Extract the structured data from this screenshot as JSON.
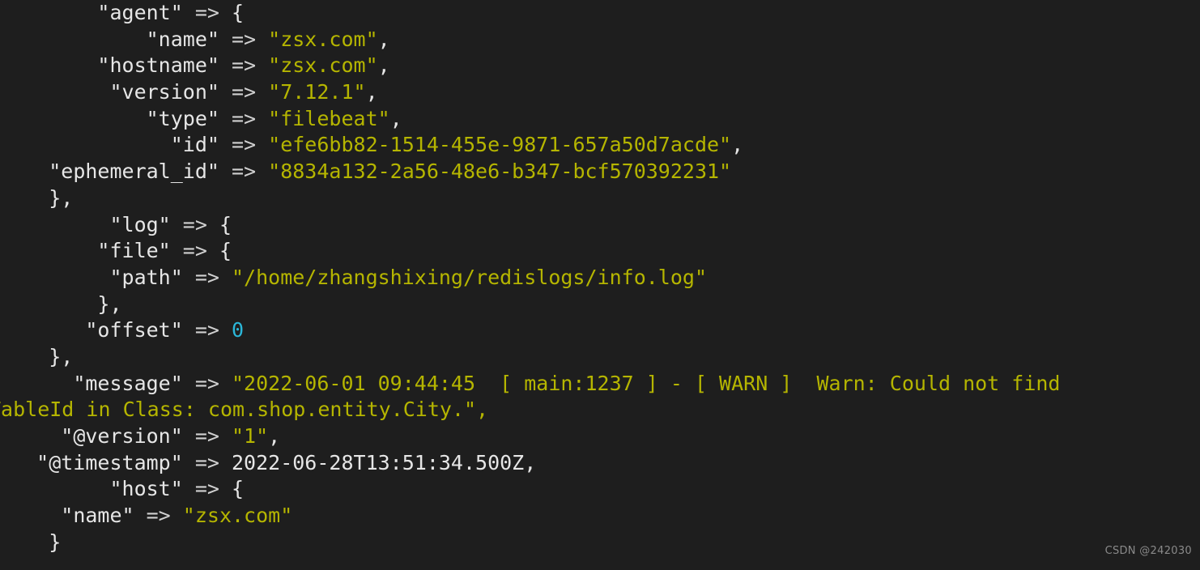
{
  "terminal": {
    "background_color": "#1e1e1e",
    "default_text_color": "#e6e6e6",
    "string_color": "#b5b500",
    "number_color": "#2bb7d9",
    "font_size_px": 25,
    "watermark": "CSDN @242030"
  },
  "output": {
    "format": "logstash-rubydebug",
    "lines": [
      {
        "id": "agent-open",
        "indent": "        ",
        "key": "\"agent\"",
        "arrow": " => ",
        "value": "{",
        "value_type": "brace"
      },
      {
        "id": "agent-name",
        "indent": "            ",
        "key": "\"name\"",
        "arrow": " => ",
        "value": "\"zsx.com\"",
        "value_type": "str",
        "trailing": ","
      },
      {
        "id": "agent-hostname",
        "indent": "        ",
        "key": "\"hostname\"",
        "arrow": " => ",
        "value": "\"zsx.com\"",
        "value_type": "str",
        "trailing": ","
      },
      {
        "id": "agent-version",
        "indent": "         ",
        "key": "\"version\"",
        "arrow": " => ",
        "value": "\"7.12.1\"",
        "value_type": "str",
        "trailing": ","
      },
      {
        "id": "agent-type",
        "indent": "            ",
        "key": "\"type\"",
        "arrow": " => ",
        "value": "\"filebeat\"",
        "value_type": "str",
        "trailing": ","
      },
      {
        "id": "agent-id",
        "indent": "              ",
        "key": "\"id\"",
        "arrow": " => ",
        "value": "\"efe6bb82-1514-455e-9871-657a50d7acde\"",
        "value_type": "str",
        "trailing": ","
      },
      {
        "id": "agent-ephemeral-id",
        "indent": "    ",
        "key": "\"ephemeral_id\"",
        "arrow": " => ",
        "value": "\"8834a132-2a56-48e6-b347-bcf570392231\"",
        "value_type": "str"
      },
      {
        "id": "agent-close",
        "indent": "    ",
        "value": "},",
        "value_type": "brace"
      },
      {
        "id": "log-open",
        "indent": "         ",
        "key": "\"log\"",
        "arrow": " => ",
        "value": "{",
        "value_type": "brace"
      },
      {
        "id": "log-file-open",
        "indent": "        ",
        "key": "\"file\"",
        "arrow": " => ",
        "value": "{",
        "value_type": "brace"
      },
      {
        "id": "log-file-path",
        "indent": "         ",
        "key": "\"path\"",
        "arrow": " => ",
        "value": "\"/home/zhangshixing/redislogs/info.log\"",
        "value_type": "str"
      },
      {
        "id": "log-file-close",
        "indent": "        ",
        "value": "},",
        "value_type": "brace"
      },
      {
        "id": "log-offset",
        "indent": "       ",
        "key": "\"offset\"",
        "arrow": " => ",
        "value": "0",
        "value_type": "num"
      },
      {
        "id": "log-close",
        "indent": "    ",
        "value": "},",
        "value_type": "brace"
      },
      {
        "id": "message",
        "indent": "      ",
        "key": "\"message\"",
        "arrow": " => ",
        "value": "\"2022-06-01 09:44:45  [ main:1237 ] - [ WARN ]  Warn: Could not find",
        "value_type": "str",
        "clipped_right": true
      },
      {
        "id": "message-continuation",
        "indent": "",
        "value": "TableId in Class: com.shop.entity.City.\",",
        "value_type": "str",
        "clipped_left": true
      },
      {
        "id": "version",
        "indent": "     ",
        "key": "\"@version\"",
        "arrow": " => ",
        "value": "\"1\"",
        "value_type": "str",
        "trailing": ","
      },
      {
        "id": "timestamp",
        "indent": "   ",
        "key": "\"@timestamp\"",
        "arrow": " => ",
        "value": "2022-06-28T13:51:34.500Z,",
        "value_type": "plain"
      },
      {
        "id": "host-open",
        "indent": "         ",
        "key": "\"host\"",
        "arrow": " => ",
        "value": "{",
        "value_type": "brace"
      },
      {
        "id": "host-name",
        "indent": "     ",
        "key": "\"name\"",
        "arrow": " => ",
        "value": "\"zsx.com\"",
        "value_type": "str"
      },
      {
        "id": "root-close",
        "indent": "    ",
        "value": "}",
        "value_type": "brace"
      }
    ]
  }
}
